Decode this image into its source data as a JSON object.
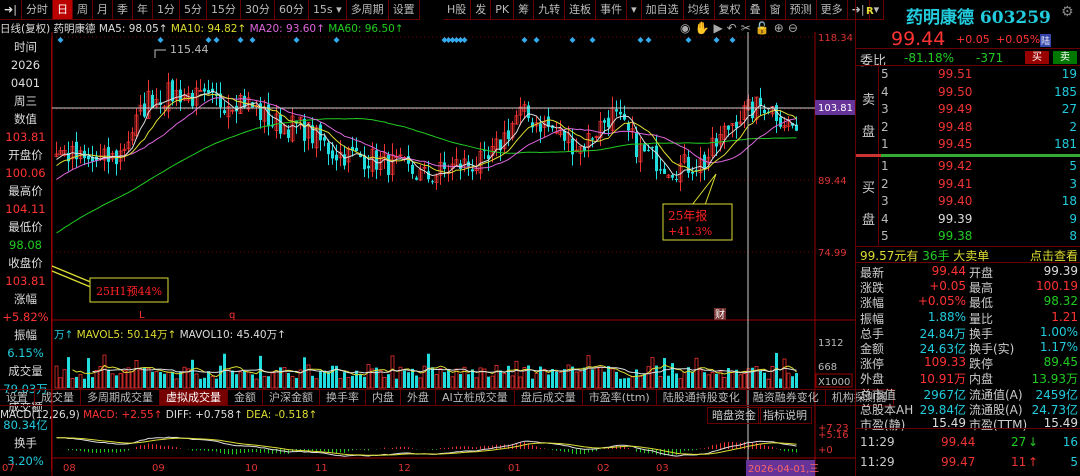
{
  "toolbar": {
    "left": [
      "分时",
      "日",
      "周",
      "月",
      "季",
      "年",
      "1分",
      "5分",
      "15分",
      "30分",
      "60分",
      "15s ▾",
      "多周期",
      "设置"
    ],
    "active": "日",
    "right": [
      "H股",
      "发",
      "PK",
      "筹",
      "九转",
      "连板",
      "事件",
      "▾",
      "加自选",
      "均线",
      "复权",
      "叠",
      "窗",
      "预测",
      "更多",
      "➜|",
      "▾"
    ]
  },
  "legend": {
    "period": "日线(复权)",
    "name": "药明康德",
    "ma5": "MA5: 98.05↑",
    "ma10": "MA10: 94.82↑",
    "ma20": "MA20: 93.60↑",
    "ma60": "MA60: 96.50↑"
  },
  "tools": [
    "eye-icon",
    "hand-icon",
    "play-icon",
    "undo-icon",
    "scissors-icon",
    "lock-icon",
    "zoom-in-icon",
    "zoom-out-icon"
  ],
  "info_panel": [
    [
      "时间",
      "wht"
    ],
    [
      "2026",
      "wht"
    ],
    [
      "0401",
      "wht"
    ],
    [
      "周三",
      "wht"
    ],
    [
      "数值",
      "wht"
    ],
    [
      "103.81",
      "red"
    ],
    [
      "开盘价",
      "wht"
    ],
    [
      "100.06",
      "red"
    ],
    [
      "最高价",
      "wht"
    ],
    [
      "104.11",
      "red"
    ],
    [
      "最低价",
      "wht"
    ],
    [
      "98.08",
      "grn"
    ],
    [
      "收盘价",
      "wht"
    ],
    [
      "103.81",
      "red"
    ],
    [
      "涨幅",
      "wht"
    ],
    [
      "+5.82%",
      "red"
    ],
    [
      "振幅",
      "wht"
    ],
    [
      "6.15%",
      "cyan"
    ],
    [
      "成交量",
      "wht"
    ],
    [
      "79.03万",
      "cyan"
    ],
    [
      "成交额",
      "wht"
    ],
    [
      "80.34亿",
      "cyan"
    ],
    [
      "换手",
      "wht"
    ],
    [
      "3.20%",
      "cyan"
    ]
  ],
  "price_axis": [
    "118.34",
    "103.81",
    "89.44",
    "74.99"
  ],
  "cursor_price": "103.81",
  "high_label": "115.44",
  "annotations": {
    "h1": "25H1预44%",
    "annual_1": "25年报",
    "annual_2": "+41.3%",
    "marker_l": "L",
    "marker_q": "q",
    "marker_cai": "财"
  },
  "approx_closes": [
    95.6,
    93,
    94,
    106,
    107,
    105,
    106,
    101,
    100,
    95,
    94,
    92.5,
    90,
    92.5,
    93,
    103,
    100,
    96,
    103,
    95,
    92,
    93,
    102,
    105,
    99.44
  ],
  "colors": {
    "up": "#e33",
    "down": "#2dd",
    "ma5": "#ddd",
    "ma10": "#dd3",
    "ma20": "#d6d",
    "ma60": "#2c2",
    "bg": "#000",
    "grid": "#700"
  },
  "volume": {
    "unit": "万↑",
    "mavol5": "MAVOL5: 50.14万↑",
    "mavol10": "MAVOL10: 45.40万↑",
    "axis": [
      "1312",
      "668",
      "X1000"
    ]
  },
  "tabs": [
    "设置",
    "成交量",
    "多周期成交量",
    "虚拟成交量",
    "金额",
    "沪深金额",
    "换手率",
    "内盘",
    "外盘",
    "AI立桩成交量",
    "盘后成交量",
    "市盈率(ttm)",
    "陆股通持股变化",
    "融资融券变化",
    "机构探测器"
  ],
  "tab_active": "虚拟成交量",
  "macd": {
    "name": "MACD(12,26,9)",
    "macd": "MACD: +2.55↑",
    "diff": "DIFF: +0.758↑",
    "dea": "DEA: -0.518↑",
    "axis": [
      "+7.23",
      "+5.16",
      "+0"
    ],
    "btn1": "暗盘资金",
    "btn2": "指标说明"
  },
  "months": [
    "07",
    "08",
    "09",
    "10",
    "11",
    "12",
    "01",
    "02",
    "03"
  ],
  "cursor_date": "2026-04-01,三",
  "quote": {
    "r": "R",
    "title": "药明康德 603259",
    "price": "99.44",
    "chg": "+0.05",
    "pct": "+0.05%",
    "badge": "陆",
    "wb_label": "委比",
    "wb": "-81.18%",
    "wc": "-371",
    "buy": "买",
    "sell": "卖"
  },
  "sell": [
    [
      "5",
      "99.51",
      "19"
    ],
    [
      "4",
      "99.50",
      "185"
    ],
    [
      "3",
      "99.49",
      "27"
    ],
    [
      "2",
      "99.48",
      "2"
    ],
    [
      "1",
      "99.45",
      "181"
    ]
  ],
  "buyb": [
    [
      "1",
      "99.42",
      "5"
    ],
    [
      "2",
      "99.41",
      "3"
    ],
    [
      "3",
      "99.40",
      "18"
    ],
    [
      "4",
      "99.39",
      "9"
    ],
    [
      "5",
      "99.38",
      "8"
    ]
  ],
  "sell_label": [
    "卖",
    "盘"
  ],
  "buy_label": [
    "买",
    "盘"
  ],
  "bigorder": {
    "price": "99.57元有",
    "qty": "36手",
    "type": "大卖单",
    "link": "点击查看"
  },
  "stats": [
    [
      "最新",
      "99.44",
      "red",
      "开盘",
      "99.39",
      "wht"
    ],
    [
      "涨跌",
      "+0.05",
      "red",
      "最高",
      "100.19",
      "red"
    ],
    [
      "涨幅",
      "+0.05%",
      "red",
      "最低",
      "98.32",
      "grn"
    ],
    [
      "振幅",
      "1.88%",
      "cyan",
      "量比",
      "1.21",
      "red"
    ],
    [
      "总手",
      "24.84万",
      "cyan",
      "换手",
      "1.00%",
      "cyan"
    ],
    [
      "金额",
      "24.63亿",
      "cyan",
      "换手(实)",
      "1.17%",
      "cyan"
    ],
    [
      "涨停",
      "109.33",
      "red",
      "跌停",
      "89.45",
      "grn"
    ],
    [
      "外盘",
      "10.91万",
      "red",
      "内盘",
      "13.93万",
      "grn"
    ],
    [
      "总市值",
      "2967亿",
      "cyan",
      "流通值(A)",
      "2459亿",
      "cyan"
    ],
    [
      "总股本AH",
      "29.84亿",
      "cyan",
      "流通股(A)",
      "24.73亿",
      "cyan"
    ],
    [
      "市盈(静)",
      "15.49",
      "wht",
      "市盈(TTM)",
      "15.49",
      "wht"
    ]
  ],
  "ticks": [
    [
      "11:29",
      "99.44",
      "27",
      "↓",
      "16"
    ],
    [
      "11:29",
      "99.47",
      "11",
      "↑",
      "5"
    ]
  ]
}
